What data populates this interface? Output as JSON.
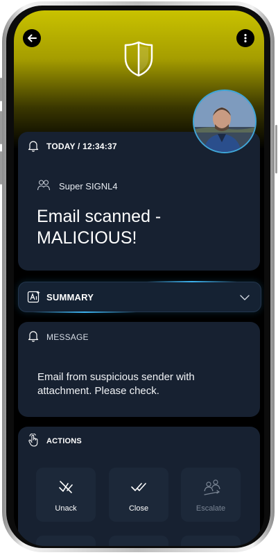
{
  "notification": {
    "time_label": "TODAY / 12:34:37",
    "team": "Super SIGNL4",
    "title": "Email scanned - MALICIOUS!"
  },
  "summary": {
    "label": "SUMMARY"
  },
  "message": {
    "label": "MESSAGE",
    "body": "Email from suspicious sender with attachment. Please check."
  },
  "actions": {
    "label": "ACTIONS",
    "buttons": [
      {
        "label": "Unack",
        "icon": "unack-icon",
        "enabled": true
      },
      {
        "label": "Close",
        "icon": "double-check-icon",
        "enabled": true
      },
      {
        "label": "Escalate",
        "icon": "escalate-icon",
        "enabled": false
      }
    ]
  },
  "colors": {
    "header": "#c9c200",
    "card": "#172131",
    "accent": "#3db3f0"
  }
}
